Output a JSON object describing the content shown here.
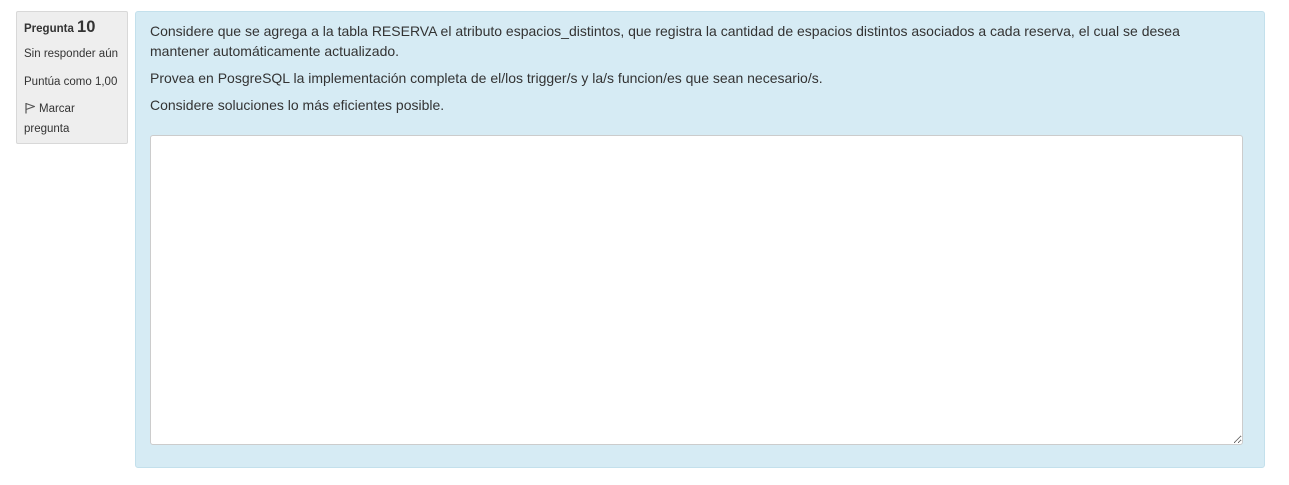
{
  "question_info": {
    "label": "Pregunta",
    "number": "10",
    "state": "Sin responder aún",
    "grade": "Puntúa como 1,00",
    "flag_label": "Marcar pregunta",
    "flag_icon": "flag-icon"
  },
  "question_text": {
    "paragraphs": [
      "Considere que se agrega a la tabla RESERVA el atributo espacios_distintos, que registra la cantidad de espacios distintos asociados a cada reserva, el cual se desea mantener automáticamente actualizado.",
      "Provea en PosgreSQL la implementación completa de el/los trigger/s y la/s funcion/es que sean necesario/s.",
      "Considere soluciones lo más eficientes posible."
    ]
  },
  "answer": {
    "value": ""
  },
  "colors": {
    "content_background": "#d6ebf4",
    "info_background": "#eeeeee"
  }
}
